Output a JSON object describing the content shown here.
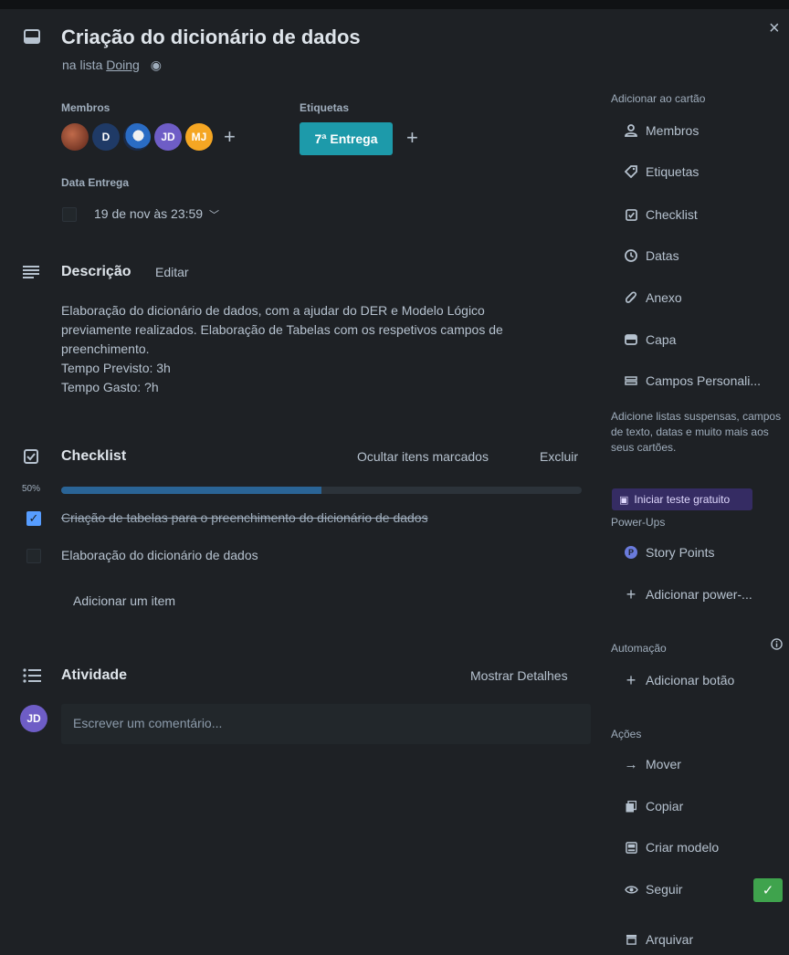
{
  "card": {
    "title": "Criação do dicionário de dados",
    "list_prefix": "na lista",
    "list_name": "Doing"
  },
  "members": {
    "label": "Membros",
    "avatars": [
      {
        "initials": "",
        "color": "#8a3b2a"
      },
      {
        "initials": "D",
        "color": "#1f3a66"
      },
      {
        "initials": "",
        "color": "#2a6cc4"
      },
      {
        "initials": "JD",
        "color": "#6e5dc6"
      },
      {
        "initials": "MJ",
        "color": "#f5a623"
      }
    ]
  },
  "labels": {
    "label": "Etiquetas",
    "items": [
      "7ª Entrega"
    ],
    "tag_color": "#1d9aaa"
  },
  "due": {
    "label": "Data Entrega",
    "value": "19 de nov às 23:59"
  },
  "description": {
    "heading": "Descrição",
    "edit": "Editar",
    "lines": [
      "Elaboração do dicionário de dados, com a ajudar do DER e Modelo Lógico",
      "previamente realizados. Elaboração de Tabelas com os respetivos campos de",
      "preenchimento.",
      "Tempo Previsto: 3h",
      "Tempo Gasto: ?h"
    ]
  },
  "checklist": {
    "heading": "Checklist",
    "hide_checked": "Ocultar itens marcados",
    "delete": "Excluir",
    "percent_label": "50%",
    "progress": 0.5,
    "items": [
      {
        "text": "Criação de tabelas para o preenchimento do dicionário de dados",
        "checked": true
      },
      {
        "text": "Elaboração do dicionário de dados",
        "checked": false
      }
    ],
    "add_item": "Adicionar um item"
  },
  "activity": {
    "heading": "Atividade",
    "show_details": "Mostrar Detalhes",
    "user_initials": "JD",
    "comment_placeholder": "Escrever um comentário..."
  },
  "sidebar": {
    "add_to_card": "Adicionar ao cartão",
    "buttons": [
      "Membros",
      "Etiquetas",
      "Checklist",
      "Datas",
      "Anexo",
      "Capa",
      "Campos Personali..."
    ],
    "promo_text": "Adicione listas suspensas, campos de texto, datas e muito mais aos seus cartões.",
    "trial_button": "Iniciar teste gratuito",
    "powerups_label": "Power-Ups",
    "powerups": [
      "Story Points",
      "Adicionar power-..."
    ],
    "automation_label": "Automação",
    "automation": [
      "Adicionar botão"
    ],
    "actions_label": "Ações",
    "actions": [
      "Mover",
      "Copiar",
      "Criar modelo",
      "Seguir",
      "Arquivar"
    ]
  },
  "close_glyph": "×"
}
